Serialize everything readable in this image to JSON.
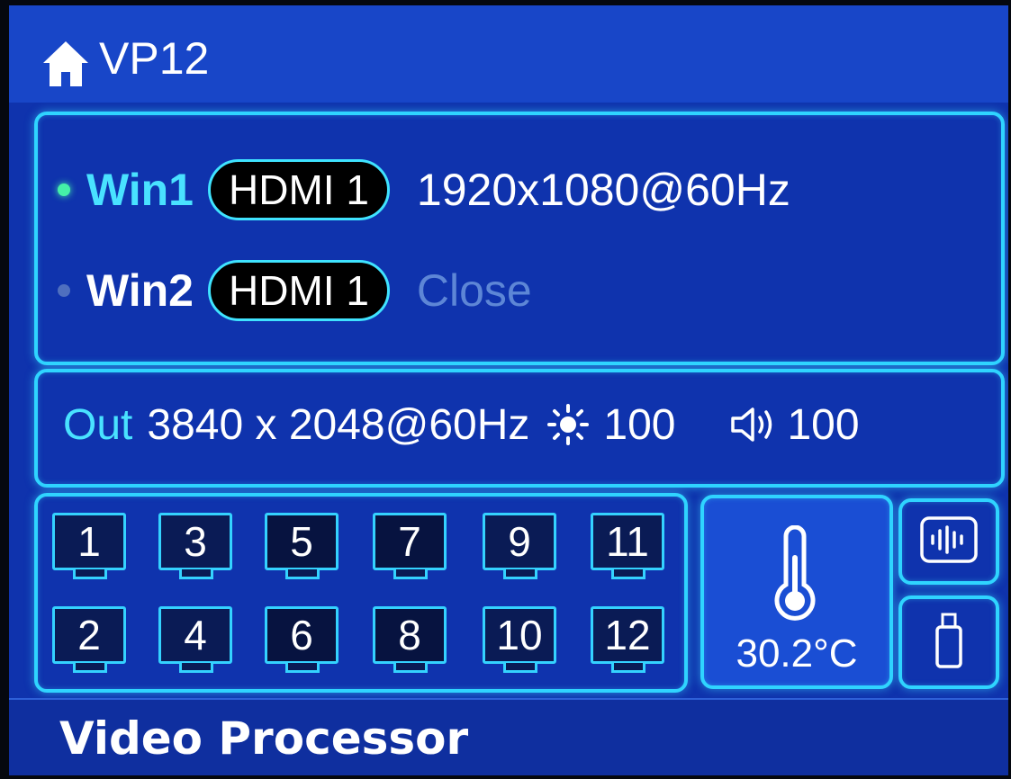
{
  "header": {
    "device_name": "VP12",
    "icon": "home-icon"
  },
  "windows": [
    {
      "label": "Win1",
      "status": "active",
      "source": "HDMI 1",
      "resolution": "1920x1080@60Hz"
    },
    {
      "label": "Win2",
      "status": "inactive",
      "source": "HDMI 1",
      "resolution": "Close"
    }
  ],
  "output": {
    "label": "Out",
    "resolution": "3840 x 2048@60Hz",
    "brightness_icon": "sun-icon",
    "brightness": "100",
    "volume_icon": "speaker-icon",
    "volume": "100"
  },
  "ports": {
    "top_row": [
      "1",
      "3",
      "5",
      "7",
      "9",
      "11"
    ],
    "bottom_row": [
      "2",
      "4",
      "6",
      "8",
      "10",
      "12"
    ]
  },
  "status": {
    "temperature": "30.2°C",
    "temperature_icon": "thermometer-icon",
    "audio_icon": "audio-wave-icon",
    "usb_icon": "usb-drive-icon"
  },
  "footer": {
    "label": "Video Processor"
  },
  "colors": {
    "screen_bg": "#0f33ad",
    "accent": "#2fd4ff",
    "active_text": "#49e2ff",
    "active_dot": "#45f0a8"
  }
}
